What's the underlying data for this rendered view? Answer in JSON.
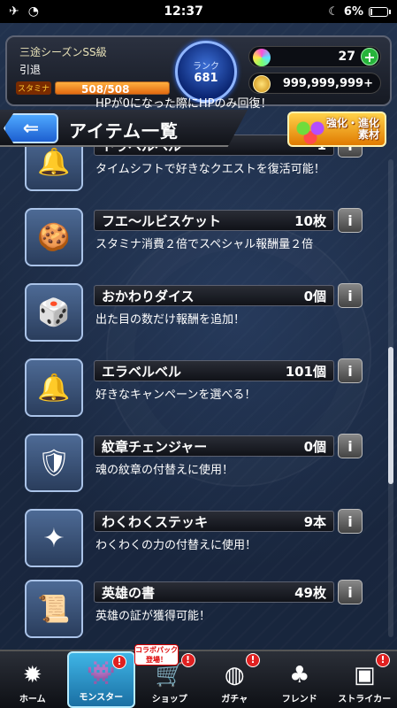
{
  "status_bar": {
    "time": "12:37",
    "battery": "6%"
  },
  "header": {
    "rank_title": "三途シーズンSS級",
    "status_label": "引退",
    "stamina_label": "スタミナ",
    "stamina_value": "508/508",
    "stamina_fraction": 1.0,
    "rank_label": "ランク",
    "rank_value": "681",
    "gems": "27",
    "gold": "999,999,999+"
  },
  "title_bar": {
    "back_arrow": "⇐",
    "title": "アイテム一覧",
    "evolve_label_1": "強化・進化",
    "evolve_label_2": "素材"
  },
  "items": [
    {
      "name": "",
      "count": "",
      "desc": "HPが0になった際にHPのみ回復！",
      "icon": "heart-icon"
    },
    {
      "name": "トラベルベル",
      "count": "1",
      "desc": "タイムシフトで好きなクエストを復活可能！",
      "icon": "bell-icon"
    },
    {
      "name": "フエ〜ルビスケット",
      "count": "10枚",
      "desc": "スタミナ消費２倍でスペシャル報酬量２倍",
      "icon": "biscuit-icon"
    },
    {
      "name": "おかわりダイス",
      "count": "0個",
      "desc": "出た目の数だけ報酬を追加！",
      "icon": "dice-icon"
    },
    {
      "name": "エラベルベル",
      "count": "101個",
      "desc": "好きなキャンペーンを選べる！",
      "icon": "gold-bell-icon"
    },
    {
      "name": "紋章チェンジャー",
      "count": "0個",
      "desc": "魂の紋章の付替えに使用！",
      "icon": "emblem-icon"
    },
    {
      "name": "わくわくステッキ",
      "count": "9本",
      "desc": "わくわくの力の付替えに使用！",
      "icon": "wand-icon"
    },
    {
      "name": "英雄の書",
      "count": "49枚",
      "desc": "英雄の証が獲得可能！",
      "icon": "scroll-icon"
    }
  ],
  "bottom_nav": [
    {
      "label": "ホーム",
      "icon": "home-icon",
      "badge": ""
    },
    {
      "label": "モンスター",
      "icon": "monster-icon",
      "badge": "!"
    },
    {
      "label": "ショップ",
      "icon": "cart-icon",
      "badge": "!"
    },
    {
      "label": "ガチャ",
      "icon": "gacha-icon",
      "badge": "!"
    },
    {
      "label": "フレンド",
      "icon": "friend-icon",
      "badge": ""
    },
    {
      "label": "ストライカー",
      "icon": "striker-icon",
      "badge": "!"
    }
  ],
  "collab_tag": "コラボパック登場！",
  "info_glyph": "i"
}
